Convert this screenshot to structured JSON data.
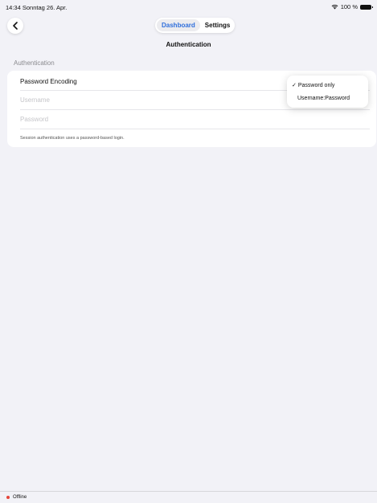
{
  "status_bar": {
    "time": "14:34",
    "date": "Sonntag 26. Apr.",
    "battery": "100 %",
    "wifi_icon": "wifi-icon",
    "battery_icon": "battery-icon"
  },
  "nav": {
    "back_icon": "chevron-left-icon",
    "segments": [
      {
        "label": "Dashboard",
        "active": true
      },
      {
        "label": "Settings",
        "active": false
      }
    ],
    "title": "Authentication"
  },
  "section": {
    "header": "Authentication",
    "rows": {
      "password_encoding": "Password Encoding",
      "username_placeholder": "Username",
      "password_placeholder": "Password"
    },
    "footnote": "Session authentication uses a password-based login."
  },
  "dropdown": {
    "options": [
      {
        "label": "Password only",
        "selected": true
      },
      {
        "label": "Username:Password",
        "selected": false
      }
    ],
    "check_mark": "✓"
  },
  "footer": {
    "status": "Offline",
    "status_color": "#e5453a"
  },
  "colors": {
    "accent": "#2f6fdc",
    "background": "#f2f2f7"
  }
}
